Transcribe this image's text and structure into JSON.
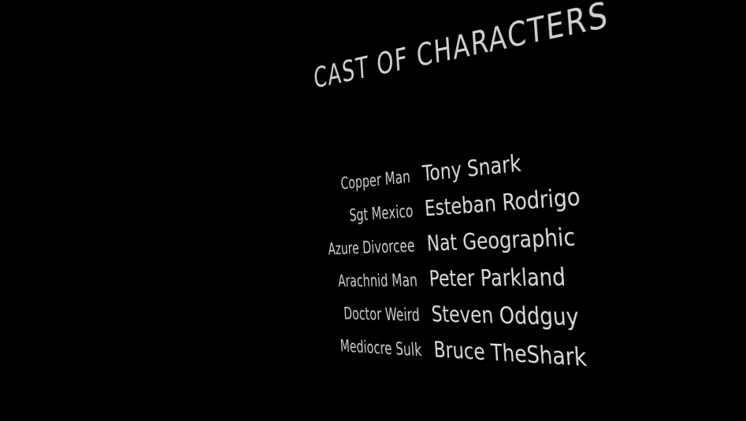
{
  "title": "CAST OF CHARACTERS",
  "cast": [
    {
      "role": "Copper Man",
      "actor": "Tony Snark"
    },
    {
      "role": "Sgt Mexico",
      "actor": "Esteban Rodrigo"
    },
    {
      "role": "Azure Divorcee",
      "actor": "Nat Geographic"
    },
    {
      "role": "Arachnid Man",
      "actor": "Peter Parkland"
    },
    {
      "role": "Doctor Weird",
      "actor": "Steven Oddguy"
    },
    {
      "role": "Mediocre Sulk",
      "actor": "Bruce TheShark"
    }
  ],
  "colors": {
    "background": "#000000",
    "text": "#d0d0d0"
  }
}
